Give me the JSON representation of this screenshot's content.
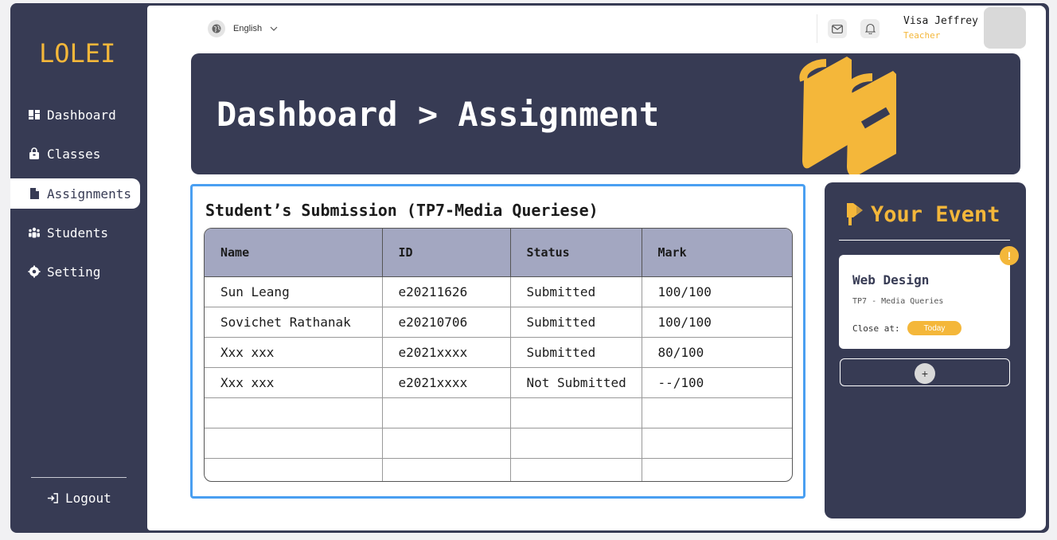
{
  "app": {
    "logo": "LOLEI"
  },
  "sidebar": {
    "items": [
      {
        "label": "Dashboard",
        "icon": "dashboard-icon"
      },
      {
        "label": "Classes",
        "icon": "lock-bag-icon"
      },
      {
        "label": "Assignments",
        "icon": "document-icon"
      },
      {
        "label": "Students",
        "icon": "users-icon"
      },
      {
        "label": "Setting",
        "icon": "gear-icon"
      }
    ],
    "active": "Assignments",
    "logout_label": "Logout"
  },
  "topbar": {
    "language": "English",
    "user": {
      "name": "Visa Jeffrey",
      "role": "Teacher"
    }
  },
  "banner": {
    "title": "Dashboard > Assignment"
  },
  "submissions": {
    "title": "Student’s Submission (TP7-Media Queriese)",
    "columns": [
      "Name",
      "ID",
      "Status",
      "Mark"
    ],
    "rows": [
      [
        "Sun Leang",
        "e20211626",
        "Submitted",
        "100/100"
      ],
      [
        "Sovichet Rathanak",
        "e20210706",
        "Submitted",
        "100/100"
      ],
      [
        "Xxx xxx",
        "e2021xxxx",
        "Submitted",
        "80/100"
      ],
      [
        "Xxx xxx",
        "e2021xxxx",
        "Not Submitted",
        "--/100"
      ],
      [
        "",
        "",
        "",
        ""
      ],
      [
        "",
        "",
        "",
        ""
      ],
      [
        "",
        "",
        "",
        ""
      ]
    ]
  },
  "events": {
    "title": "Your Event",
    "cards": [
      {
        "title": "Web Design",
        "subtitle": "TP7 - Media Queries",
        "close_label": "Close at:",
        "close_value": "Today",
        "alert": "!"
      }
    ],
    "add_label": "+"
  },
  "colors": {
    "navy": "#373b54",
    "accent": "#f4b73a",
    "header_row": "#a3a7c1",
    "selection": "#4a9ff1"
  }
}
